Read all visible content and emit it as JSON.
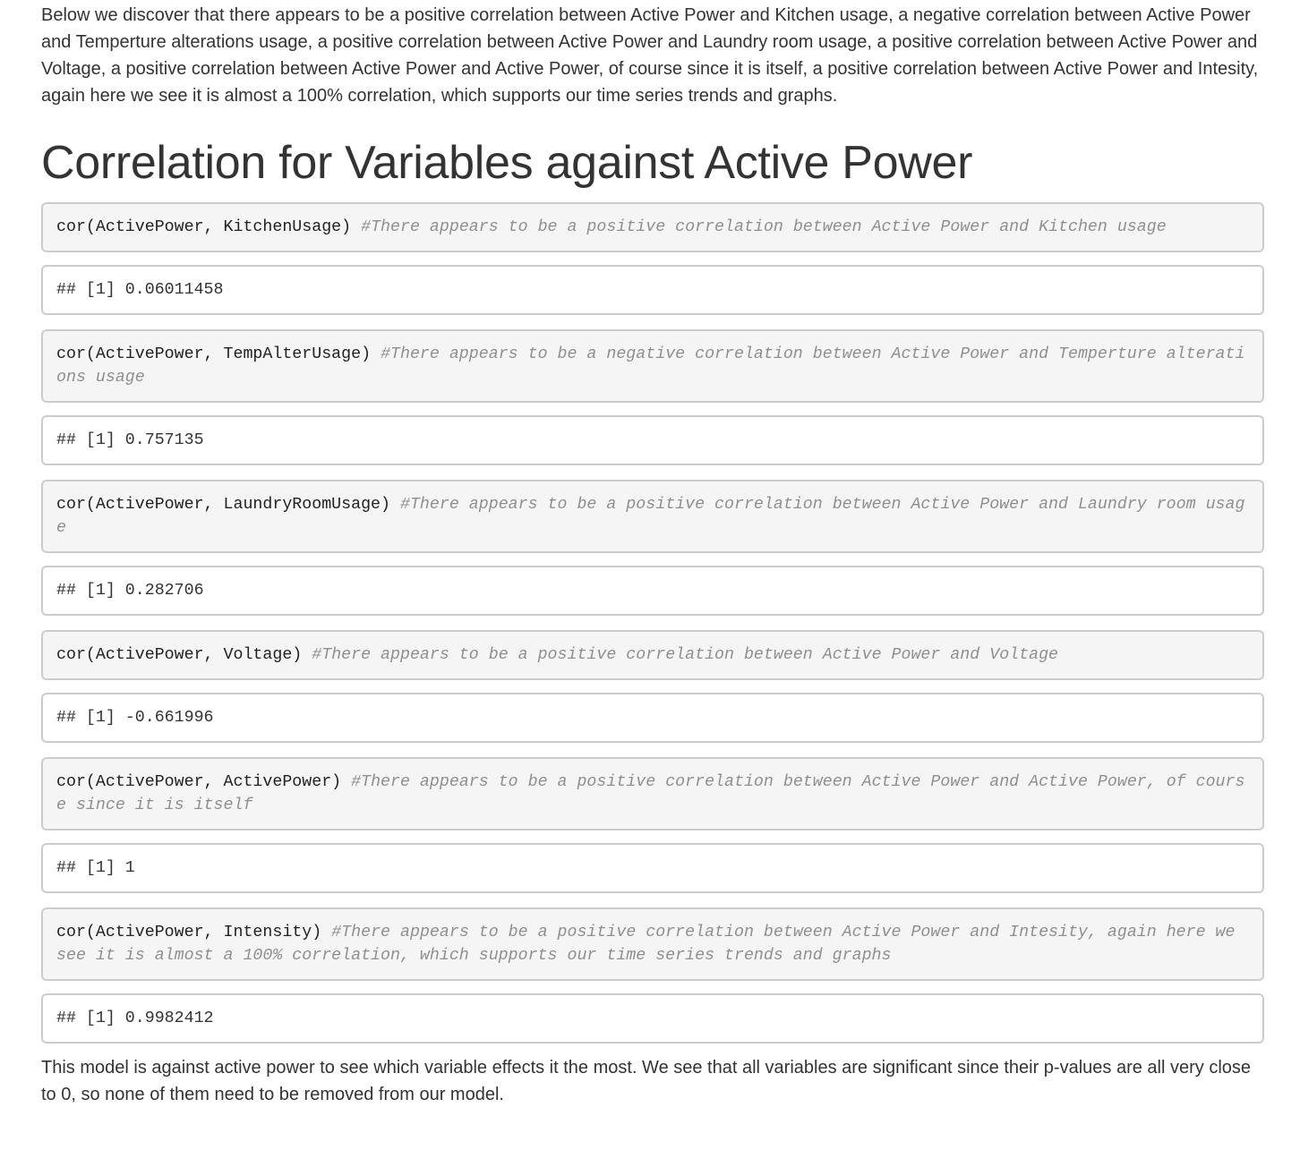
{
  "intro_paragraph": "Below we discover that there appears to be a positive correlation between Active Power and Kitchen usage, a negative correlation between Active Power and Temperture alterations usage, a positive correlation between Active Power and Laundry room usage, a positive correlation between Active Power and Voltage, a positive correlation between Active Power and Active Power, of course since it is itself, a positive correlation between Active Power and Intesity, again here we see it is almost a 100% correlation, which supports our time series trends and graphs.",
  "section_heading": "Correlation for Variables against Active Power",
  "chunks": [
    {
      "code": "cor(ActivePower, KitchenUsage)",
      "comment": "#There appears to be a positive correlation between Active Power and Kitchen usage",
      "output": "## [1] 0.06011458"
    },
    {
      "code": "cor(ActivePower, TempAlterUsage)",
      "comment": "#There appears to be a negative correlation between Active Power and Temperture alterations usage",
      "output": "## [1] 0.757135"
    },
    {
      "code": "cor(ActivePower, LaundryRoomUsage)",
      "comment": "#There appears to be a positive correlation between Active Power and Laundry room usage",
      "output": "## [1] 0.282706"
    },
    {
      "code": "cor(ActivePower, Voltage)",
      "comment": "#There appears to be a positive correlation between Active Power and Voltage",
      "output": "## [1] -0.661996"
    },
    {
      "code": "cor(ActivePower, ActivePower)",
      "comment": "#There appears to be a positive correlation between Active Power and Active Power, of course since it is itself",
      "output": "## [1] 1"
    },
    {
      "code": "cor(ActivePower, Intensity)",
      "comment": "#There appears to be a positive correlation between Active Power and Intesity, again here we see it is almost a 100% correlation, which supports our time series trends and graphs",
      "output": "## [1] 0.9982412"
    }
  ],
  "outro_paragraph": "This model is against active power to see which variable effects it the most. We see that all variables are significant since their p-values are all very close to 0, so none of them need to be removed from our model."
}
